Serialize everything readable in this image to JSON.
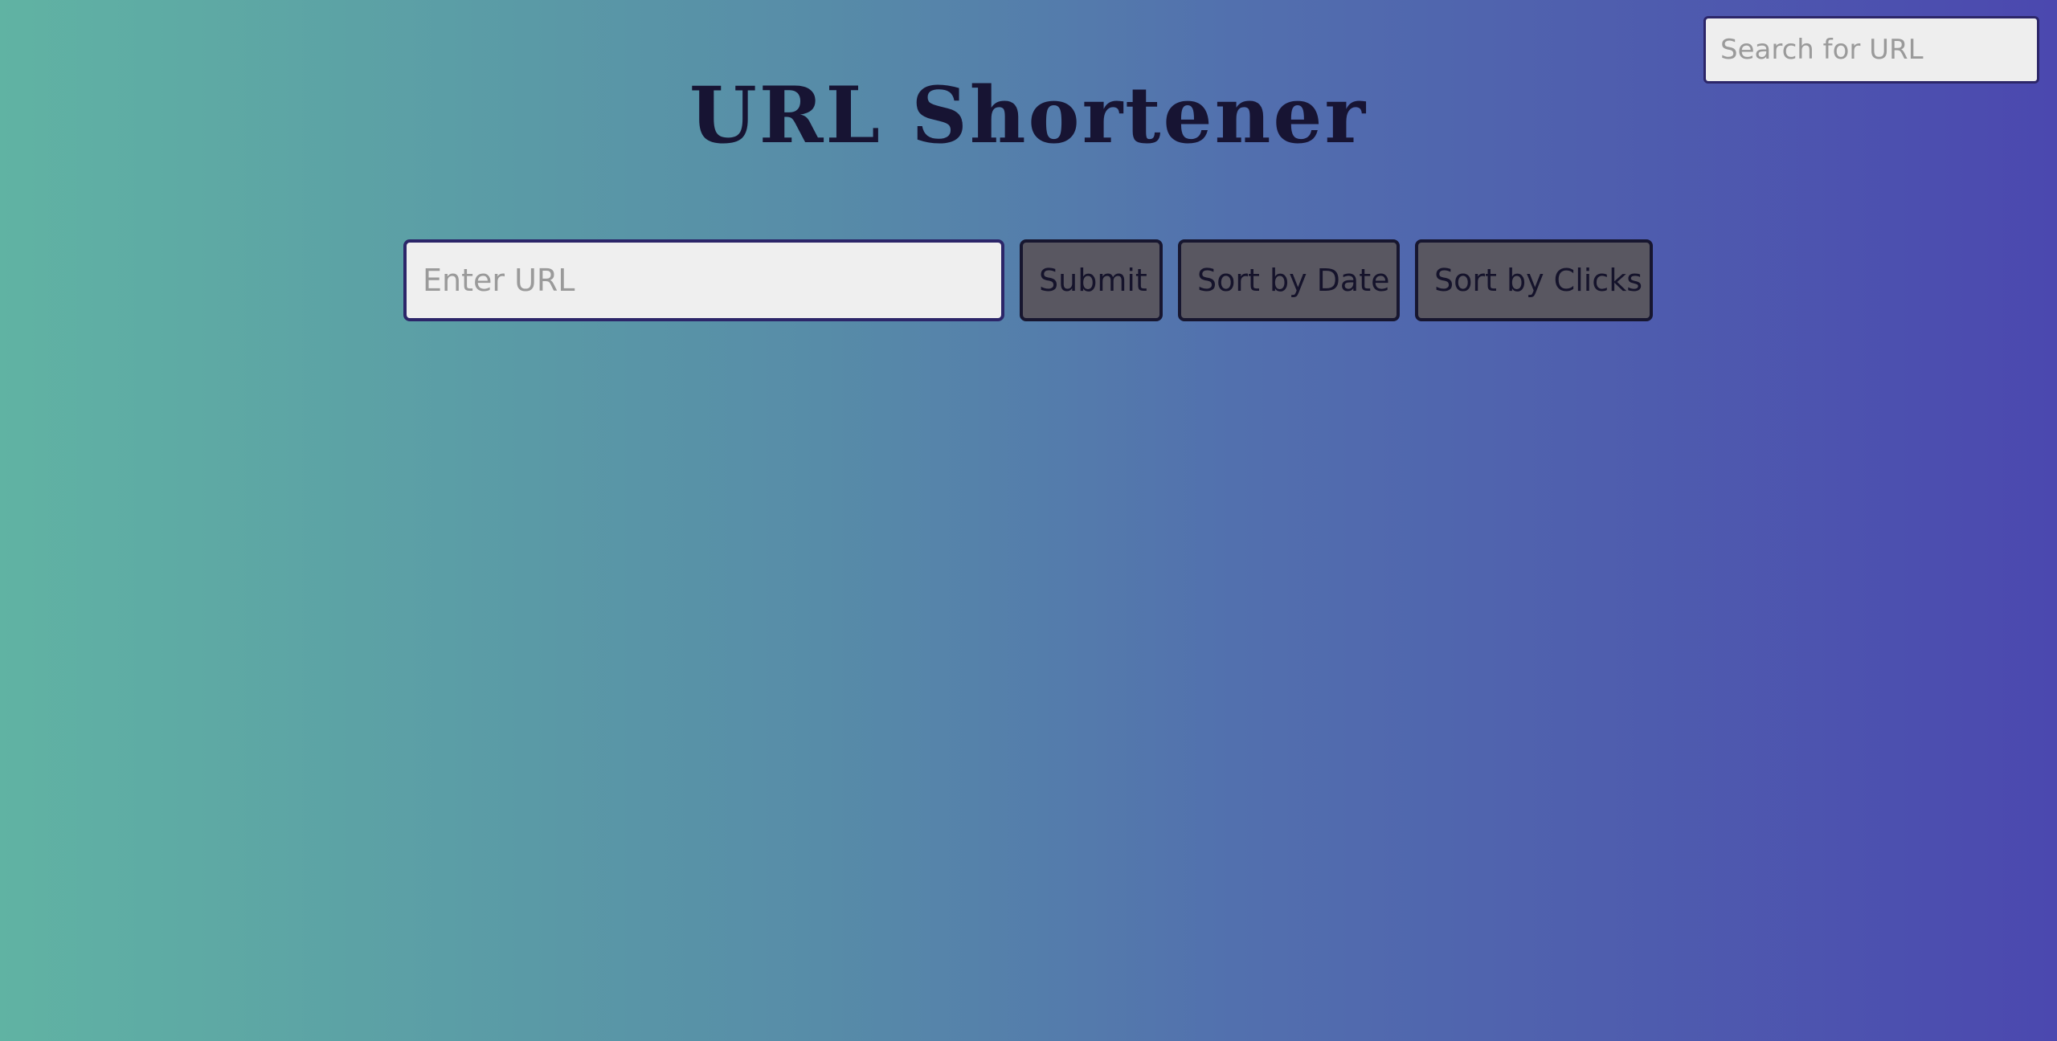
{
  "search": {
    "placeholder": "Search for URL"
  },
  "header": {
    "title": "URL Shortener"
  },
  "form": {
    "url_placeholder": "Enter URL",
    "submit_label": "Submit",
    "sort_date_label": "Sort by Date",
    "sort_clicks_label": "Sort by Clicks"
  },
  "colors": {
    "background_start": "#60b3a3",
    "background_end": "#4b48af",
    "title": "#171433",
    "input_border": "#2c2669",
    "button_bg": "#595761"
  }
}
